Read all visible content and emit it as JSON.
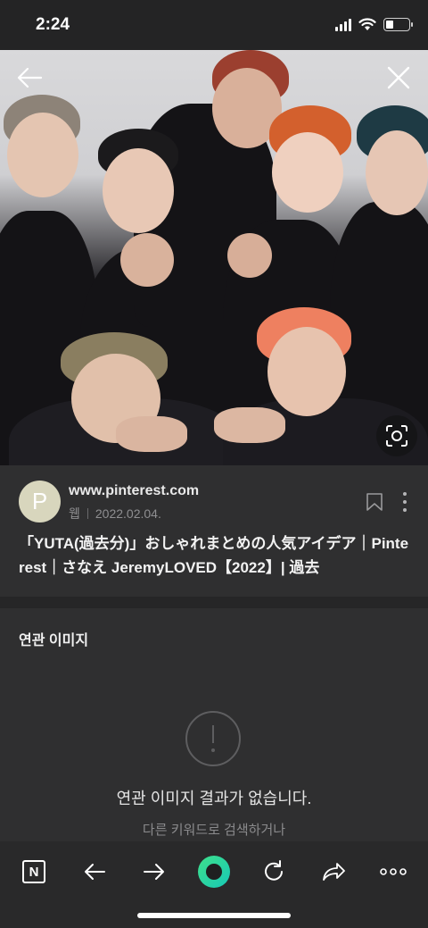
{
  "status_bar": {
    "time": "2:24"
  },
  "viewer": {
    "back_icon": "arrow-left-icon",
    "close_icon": "close-icon",
    "lens_icon": "image-search-icon"
  },
  "source": {
    "avatar_letter": "P",
    "domain": "www.pinterest.com",
    "type": "웹",
    "date": "2022.02.04.",
    "title": "「YUTA(過去分)」おしゃれまとめの人気アイデア｜Pinterest｜さなえ JeremyLOVED【2022】| 過去"
  },
  "related": {
    "heading": "연관 이미지",
    "empty_title": "연관 이미지 결과가 없습니다.",
    "empty_sub": "다른 키워드로 검색하거나"
  },
  "toolbar": {
    "items": [
      "naver-home-icon",
      "back-icon",
      "forward-icon",
      "green-dot-icon",
      "reload-icon",
      "share-icon",
      "more-icon"
    ],
    "naver_letter": "N"
  }
}
